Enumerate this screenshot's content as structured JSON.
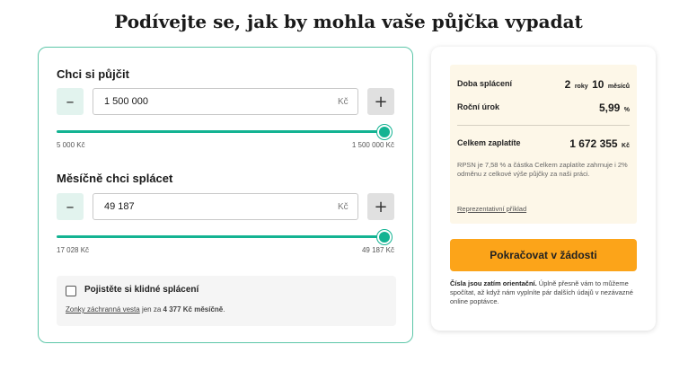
{
  "title": "Podívejte se, jak by mohla vaše půjčka vypadat",
  "loan": {
    "label": "Chci si půjčit",
    "minus": "–",
    "plus": "+",
    "value": "1 500 000",
    "currency": "Kč",
    "min_label": "5 000 Kč",
    "max_label": "1 500 000 Kč",
    "slider_fraction": 1.0
  },
  "monthly": {
    "label": "Měsíčně chci splácet",
    "minus": "–",
    "plus": "+",
    "value": "49 187",
    "currency": "Kč",
    "min_label": "17 028 Kč",
    "max_label": "49 187 Kč",
    "slider_fraction": 1.0
  },
  "insurance": {
    "label": "Pojistěte si klidné splácení",
    "link": "Zonky záchranná vesta",
    "mid": " jen za ",
    "price": "4 377 Kč měsíčně",
    "end": "."
  },
  "summary": {
    "duration_label": "Doba splácení",
    "duration_years_num": "2",
    "duration_years_unit": "roky",
    "duration_months_num": "10",
    "duration_months_unit": "měsíců",
    "rate_label": "Roční úrok",
    "rate_value": "5,99",
    "rate_unit": "%",
    "total_label": "Celkem zaplatíte",
    "total_value": "1 672 355",
    "total_unit": "Kč",
    "note": "RPSN je 7,58 % a částka Celkem zaplatíte zahrnuje i 2% odměnu z celkové výše půjčky za naši práci.",
    "example_link": "Reprezentativní příklad"
  },
  "cta": {
    "label": "Pokračovat v žádosti",
    "color": "#fca419"
  },
  "orientation": {
    "bold": "Čísla jsou zatím orientační.",
    "text": " Úplně přesně vám to můžeme spočítat, až když nám vyplníte pár dalších údajů v nezávazné online poptávce."
  },
  "colors": {
    "accent": "#13b392",
    "card_border": "#5cc6a8",
    "summary_bg": "#fdf7e8"
  }
}
